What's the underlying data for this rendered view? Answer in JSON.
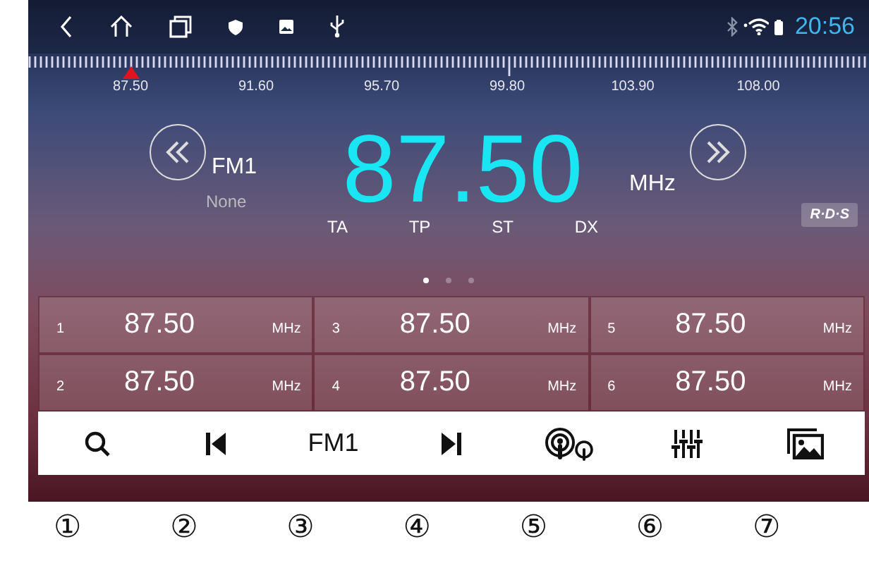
{
  "status_bar": {
    "time": "20:56"
  },
  "tuner_scale": {
    "labels": [
      "87.50",
      "91.60",
      "95.70",
      "99.80",
      "103.90",
      "108.00"
    ]
  },
  "display": {
    "band": "FM1",
    "pty": "None",
    "frequency": "87.50",
    "unit": "MHz",
    "indicators": [
      "TA",
      "TP",
      "ST",
      "DX"
    ],
    "rds": "R·D·S"
  },
  "pages": [
    {
      "selected": true
    },
    {
      "selected": false
    },
    {
      "selected": false
    }
  ],
  "presets": [
    {
      "number": "1",
      "frequency": "87.50",
      "unit": "MHz"
    },
    {
      "number": "2",
      "frequency": "87.50",
      "unit": "MHz"
    },
    {
      "number": "3",
      "frequency": "87.50",
      "unit": "MHz"
    },
    {
      "number": "4",
      "frequency": "87.50",
      "unit": "MHz"
    },
    {
      "number": "5",
      "frequency": "87.50",
      "unit": "MHz"
    },
    {
      "number": "6",
      "frequency": "87.50",
      "unit": "MHz"
    }
  ],
  "toolbar": [
    {
      "kind": "search"
    },
    {
      "kind": "previous"
    },
    {
      "kind": "band",
      "label": "FM1"
    },
    {
      "kind": "next"
    },
    {
      "kind": "podcast"
    },
    {
      "kind": "equalizer"
    },
    {
      "kind": "gallery"
    }
  ],
  "callouts": [
    "①",
    "②",
    "③",
    "④",
    "⑤",
    "⑥",
    "⑦"
  ]
}
